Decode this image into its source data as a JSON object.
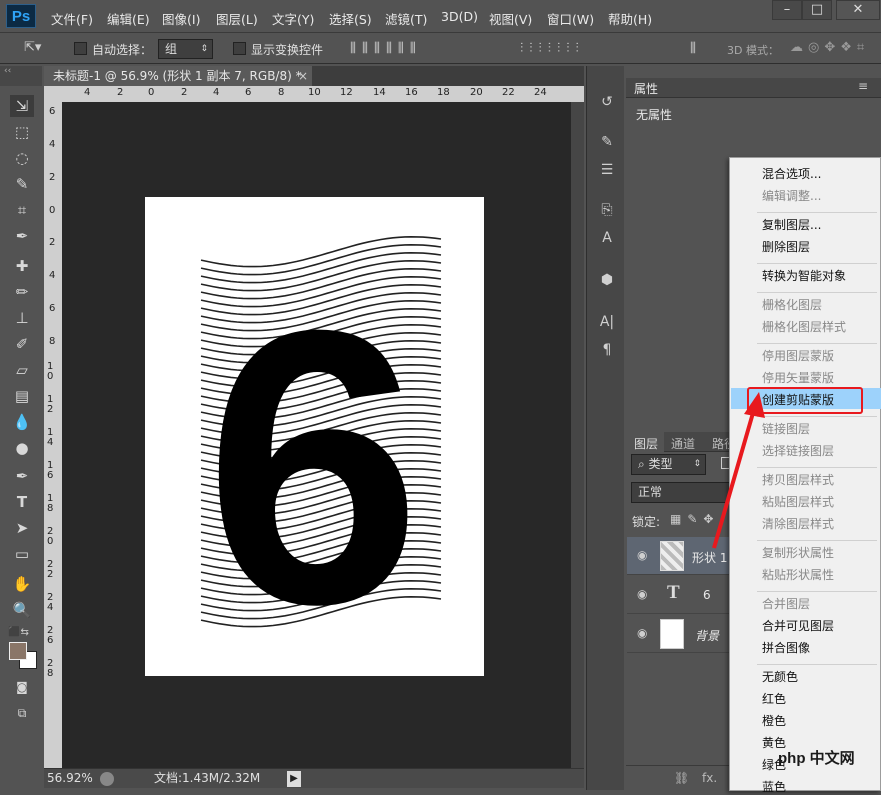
{
  "app": {
    "logo": "Ps"
  },
  "menu": [
    "文件(F)",
    "编辑(E)",
    "图像(I)",
    "图层(L)",
    "文字(Y)",
    "选择(S)",
    "滤镜(T)",
    "3D(D)",
    "视图(V)",
    "窗口(W)",
    "帮助(H)"
  ],
  "window_buttons": {
    "minimize": "–",
    "maximize": "□",
    "close": "✕"
  },
  "options": {
    "auto_select_label": "自动选择：",
    "auto_select_value": "组",
    "show_transform_label": "显示变换控件",
    "mode_3d_label": "3D 模式："
  },
  "document": {
    "tab_title": "未标题-1 @ 56.9% (形状 1 副本 7, RGB/8) *",
    "close": "×"
  },
  "ruler": {
    "h": [
      "4",
      "2",
      "0",
      "2",
      "4",
      "6",
      "8",
      "10",
      "12",
      "14",
      "16",
      "18",
      "20",
      "22",
      "24"
    ],
    "v": [
      "6",
      "4",
      "2",
      "0",
      "2",
      "4",
      "6",
      "8",
      "1 0",
      "1 2",
      "1 4",
      "1 6",
      "1 8",
      "2 0",
      "2 2",
      "2 4",
      "2 6",
      "2 8"
    ]
  },
  "canvas": {
    "glyph": "6"
  },
  "status": {
    "zoom": "56.92%",
    "doc_info": "文档:1.43M/2.32M"
  },
  "properties": {
    "title": "属性",
    "empty_text": "无属性"
  },
  "layers": {
    "tabs": [
      "图层",
      "通道",
      "路径"
    ],
    "filter_label": "类型",
    "blend_mode": "正常",
    "lock_label": "锁定:",
    "rows": [
      {
        "name": "形状 1",
        "type": "shape",
        "selected": true
      },
      {
        "name": "6",
        "type": "text",
        "selected": false
      },
      {
        "name": "背景",
        "type": "background",
        "selected": false
      }
    ],
    "footer_icons": [
      "link-icon",
      "fx-icon"
    ],
    "fx_label": "fx."
  },
  "context_menu": {
    "items": [
      {
        "label": "混合选项...",
        "enabled": true
      },
      {
        "label": "编辑调整...",
        "enabled": false
      },
      {
        "sep": true
      },
      {
        "label": "复制图层...",
        "enabled": true
      },
      {
        "label": "删除图层",
        "enabled": true
      },
      {
        "sep": true
      },
      {
        "label": "转换为智能对象",
        "enabled": true
      },
      {
        "sep": true
      },
      {
        "label": "栅格化图层",
        "enabled": false
      },
      {
        "label": "栅格化图层样式",
        "enabled": false
      },
      {
        "sep": true
      },
      {
        "label": "停用图层蒙版",
        "enabled": false
      },
      {
        "label": "停用矢量蒙版",
        "enabled": false
      },
      {
        "label": "创建剪贴蒙版",
        "enabled": true,
        "highlighted": true
      },
      {
        "sep": true
      },
      {
        "label": "链接图层",
        "enabled": false
      },
      {
        "label": "选择链接图层",
        "enabled": false
      },
      {
        "sep": true
      },
      {
        "label": "拷贝图层样式",
        "enabled": false
      },
      {
        "label": "粘贴图层样式",
        "enabled": false
      },
      {
        "label": "清除图层样式",
        "enabled": false
      },
      {
        "sep": true
      },
      {
        "label": "复制形状属性",
        "enabled": false
      },
      {
        "label": "粘贴形状属性",
        "enabled": false
      },
      {
        "sep": true
      },
      {
        "label": "合并图层",
        "enabled": false
      },
      {
        "label": "合并可见图层",
        "enabled": true
      },
      {
        "label": "拼合图像",
        "enabled": true
      },
      {
        "sep": true
      },
      {
        "label": "无颜色",
        "enabled": true
      },
      {
        "label": "红色",
        "enabled": true
      },
      {
        "label": "橙色",
        "enabled": true
      },
      {
        "label": "黄色",
        "enabled": true
      },
      {
        "label": "绿色",
        "enabled": true
      },
      {
        "label": "蓝色",
        "enabled": true
      }
    ]
  },
  "watermark": {
    "text": "php 中文网"
  },
  "colors": {
    "highlight": "#9dd2fb",
    "annotation_red": "#e8191e",
    "ps_blue": "#2fa3f6"
  }
}
